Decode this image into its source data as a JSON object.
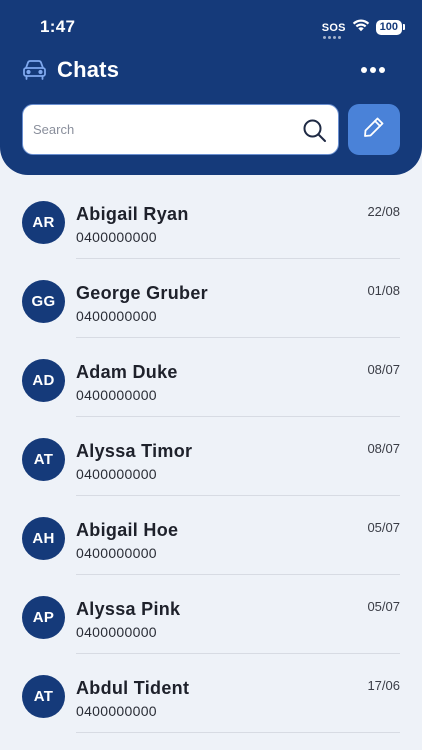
{
  "status_bar": {
    "time": "1:47",
    "sos": "SOS",
    "battery": "100"
  },
  "header": {
    "title": "Chats",
    "car_icon": "car-icon",
    "more_icon": "more-horizontal-icon"
  },
  "search": {
    "placeholder": "Search",
    "value": ""
  },
  "compose": {
    "icon": "pencil-icon"
  },
  "colors": {
    "header_bg": "#153a7a",
    "avatar_bg": "#153a7a",
    "compose_bg": "#4a82d8",
    "page_bg": "#eef2f8"
  },
  "chats": [
    {
      "initials": "AR",
      "name": "Abigail Ryan",
      "phone": "0400000000",
      "date": "22/08"
    },
    {
      "initials": "GG",
      "name": "George Gruber",
      "phone": "0400000000",
      "date": "01/08"
    },
    {
      "initials": "AD",
      "name": "Adam Duke",
      "phone": "0400000000",
      "date": "08/07"
    },
    {
      "initials": "AT",
      "name": "Alyssa Timor",
      "phone": "0400000000",
      "date": "08/07"
    },
    {
      "initials": "AH",
      "name": "Abigail Hoe",
      "phone": "0400000000",
      "date": "05/07"
    },
    {
      "initials": "AP",
      "name": "Alyssa Pink",
      "phone": "0400000000",
      "date": "05/07"
    },
    {
      "initials": "AT",
      "name": "Abdul Tident",
      "phone": "0400000000",
      "date": "17/06"
    }
  ]
}
